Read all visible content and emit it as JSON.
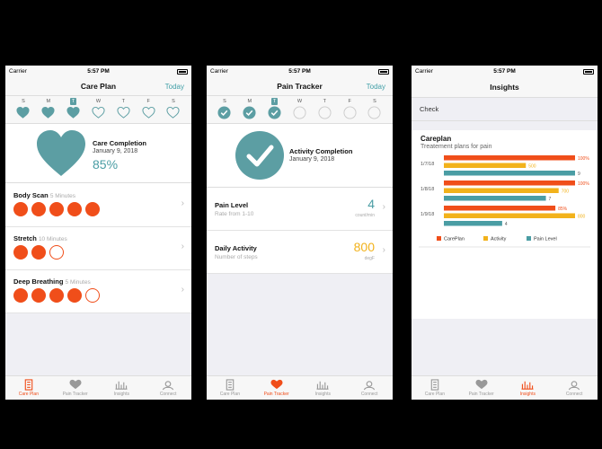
{
  "status": {
    "carrier": "Carrier",
    "time": "5:57 PM"
  },
  "weekdays": [
    "S",
    "M",
    "T",
    "W",
    "T",
    "F",
    "S"
  ],
  "colors": {
    "teal": "#5c9ea3",
    "orange": "#f04e1a",
    "yellow": "#f2b21b",
    "accent": "#43a0a8"
  },
  "tabs": [
    "Care Plan",
    "Pain Tracker",
    "Insights",
    "Connect"
  ],
  "care_plan": {
    "title": "Care Plan",
    "today": "Today",
    "summary": {
      "title": "Care Completion",
      "date": "January 9, 2018",
      "percent": "85%"
    },
    "activities": [
      {
        "title": "Body Scan",
        "subtitle": "5 Minutes",
        "completed": 5,
        "total": 5
      },
      {
        "title": "Stretch",
        "subtitle": "10 Minutes",
        "completed": 2,
        "total": 3
      },
      {
        "title": "Deep Breathing",
        "subtitle": "5 Minutes",
        "completed": 4,
        "total": 5
      }
    ]
  },
  "pain_tracker": {
    "title": "Pain Tracker",
    "today": "Today",
    "summary": {
      "title": "Activity Completion",
      "date": "January 9, 2018"
    },
    "rows": [
      {
        "title": "Pain Level",
        "subtitle": "Rate from 1-10",
        "value": "4",
        "unit": "count/min"
      },
      {
        "title": "Daily Activity",
        "subtitle": "Number of steps",
        "value": "800",
        "unit": "degF"
      }
    ]
  },
  "insights": {
    "title": "Insights",
    "check": "Check",
    "card_title": "Careplan",
    "card_subtitle": "Treatement plans for pain",
    "chart_data": {
      "type": "bar",
      "orientation": "horizontal",
      "categories": [
        "1/7/18",
        "1/8/18",
        "1/9/18"
      ],
      "series": [
        {
          "name": "CarePlan",
          "values": [
            100,
            100,
            85
          ],
          "labels": [
            "100%",
            "100%",
            "85%"
          ],
          "color": "#f04e1a"
        },
        {
          "name": "Activity",
          "values": [
            500,
            700,
            800
          ],
          "labels": [
            "500",
            "700",
            "800"
          ],
          "color": "#f2b21b"
        },
        {
          "name": "Pain Level",
          "values": [
            9,
            7,
            4
          ],
          "labels": [
            "9",
            "7",
            "4"
          ],
          "color": "#4a9da4"
        }
      ],
      "legend": "bottom"
    }
  }
}
